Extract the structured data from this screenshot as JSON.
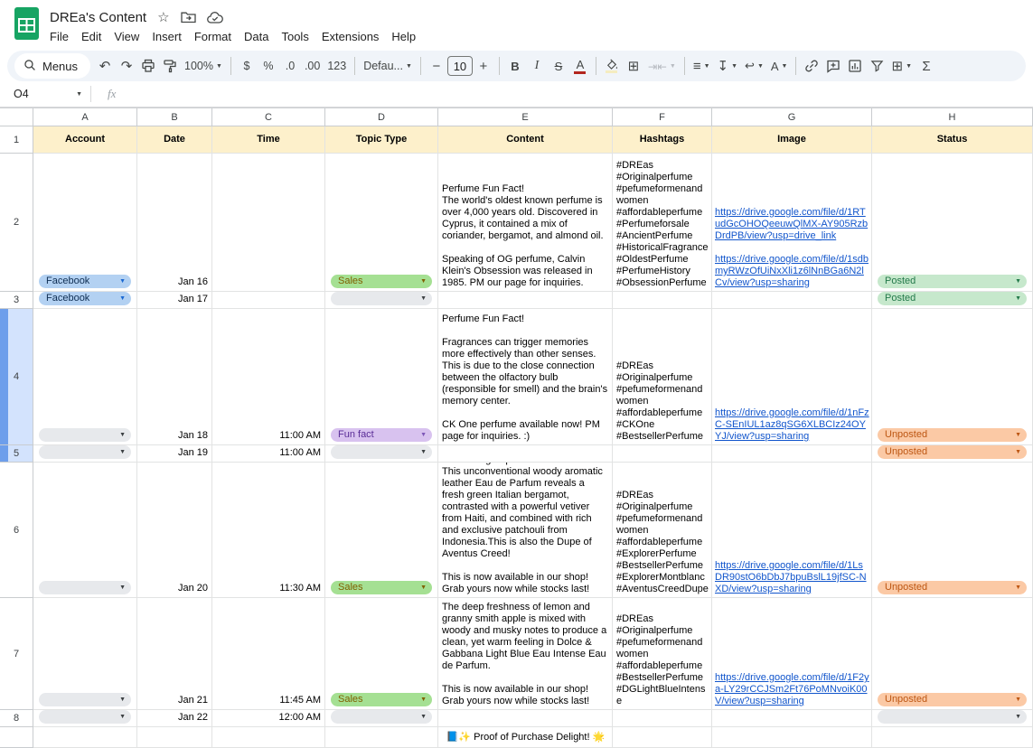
{
  "app": {
    "title": "DREa's Content",
    "menu_items": [
      "File",
      "Edit",
      "View",
      "Insert",
      "Format",
      "Data",
      "Tools",
      "Extensions",
      "Help"
    ]
  },
  "toolbar": {
    "menus_label": "Menus",
    "zoom_value": "100%",
    "currency": "$",
    "percent": "%",
    "decimal_decrease": ".0",
    "decimal_increase": ".00",
    "more_formats": "123",
    "font_family": "Defau...",
    "font_size": "10",
    "font_size_decrease": "−",
    "font_size_increase": "+",
    "bold": "B",
    "italic": "I",
    "strikethrough": "S",
    "text_color": "A",
    "text_rotation": "A",
    "sum": "Σ"
  },
  "icons": {
    "star": "☆",
    "undo": "↶",
    "redo": "↷",
    "caret": "▼",
    "align_left": "≡",
    "vertical_align": "↧",
    "text_wrap": "↩",
    "borders": "⊞",
    "merge_cells": "⇥⇤",
    "table": "⊞"
  },
  "formula_bar": {
    "cell_reference": "O4",
    "fx_label": "fx",
    "value": ""
  },
  "grid": {
    "column_letters": [
      "A",
      "B",
      "C",
      "D",
      "E",
      "F",
      "G",
      "H"
    ],
    "header_row": {
      "row_number": "1",
      "labels": [
        "Account",
        "Date",
        "Time",
        "Topic Type",
        "Content",
        "Hashtags",
        "Image",
        "Status"
      ]
    },
    "selected_rows": [
      "4",
      "5"
    ],
    "rows": [
      {
        "num": "2",
        "account": {
          "type": "facebook",
          "label": "Facebook"
        },
        "date": "Jan 16",
        "time": "",
        "topic": {
          "type": "sales",
          "label": "Sales"
        },
        "content": "Perfume Fun Fact!\nThe world's oldest known perfume is over 4,000 years old. Discovered in Cyprus, it contained a mix of coriander, bergamot, and almond oil.\n\nSpeaking of OG perfume, Calvin Klein's Obsession was released in 1985. PM our page for inquiries.",
        "hashtags": "#DREas\n#Originalperfume\n#pefumeformenandwomen\n#affordableperfume\n#Perfumeforsale\n#AncientPerfume\n#HistoricalFragrance\n#OldestPerfume\n#PerfumeHistory\n#ObsessionPerfume",
        "links": [
          "https://drive.google.com/file/d/1RTudGcOHOQeeuwQlMX-AY905RzbDrdPB/view?usp=drive_link",
          "https://drive.google.com/file/d/1sdbmyRWzOfUiNxXli1z6lNnBGa6N2lCv/view?usp=sharing"
        ],
        "status": {
          "type": "posted",
          "label": "Posted"
        }
      },
      {
        "num": "3",
        "account": {
          "type": "facebook",
          "label": "Facebook"
        },
        "date": "Jan 17",
        "time": "",
        "topic": {
          "type": "empty",
          "label": ""
        },
        "content": "",
        "hashtags": "",
        "links": [],
        "status": {
          "type": "posted",
          "label": "Posted"
        }
      },
      {
        "num": "4",
        "account": {
          "type": "empty",
          "label": ""
        },
        "date": "Jan 18",
        "time": "11:00 AM",
        "topic": {
          "type": "funfact",
          "label": "Fun fact"
        },
        "content": "Perfume Fun Fact!\n\nFragrances can trigger memories more effectively than other senses. This is due to the close connection between the olfactory bulb (responsible for smell) and the brain's memory center.\n\nCK One perfume available now! PM page for inquiries. :)",
        "hashtags": "#DREas\n#Originalperfume\n#pefumeformenandwomen\n#affordableperfume\n#CKOne\n#BestsellerPerfume",
        "links": [
          "https://drive.google.com/file/d/1nFzC-SEnIUL1az8qSG6XLBCIz24OYYJ/view?usp=sharing"
        ],
        "status": {
          "type": "unposted",
          "label": "Unposted"
        }
      },
      {
        "num": "5",
        "account": {
          "type": "empty",
          "label": ""
        },
        "date": "Jan 19",
        "time": "11:00 AM",
        "topic": {
          "type": "empty",
          "label": ""
        },
        "content": "",
        "hashtags": "",
        "links": [],
        "status": {
          "type": "unposted",
          "label": "Unposted"
        }
      },
      {
        "num": "6",
        "account": {
          "type": "empty",
          "label": ""
        },
        "date": "Jan 20",
        "time": "11:30 AM",
        "topic": {
          "type": "sales",
          "label": "Sales"
        },
        "content": "Introducing Explorer from Montblanc. This unconventional woody aromatic leather Eau de Parfum reveals a fresh green Italian bergamot, contrasted with a powerful vetiver from Haiti, and combined with rich and exclusive patchouli from Indonesia.This is also the Dupe of Aventus Creed!\n\nThis is now available in our shop! Grab yours now while stocks last!",
        "hashtags": "#DREas\n#Originalperfume\n#pefumeformenandwomen\n#affordableperfume\n#ExplorerPerfume\n#BestsellerPerfume\n#ExplorerMontblanc\n#AventusCreedDupe",
        "links": [
          "https://drive.google.com/file/d/1LsDR90stO6bDbJ7bpuBslL19jfSC-NXD/view?usp=sharing"
        ],
        "status": {
          "type": "unposted",
          "label": "Unposted"
        }
      },
      {
        "num": "7",
        "account": {
          "type": "empty",
          "label": ""
        },
        "date": "Jan 21",
        "time": "11:45 AM",
        "topic": {
          "type": "sales",
          "label": "Sales"
        },
        "content": "The deep freshness of lemon and granny smith apple is mixed with woody and musky notes to produce a clean, yet warm feeling in Dolce & Gabbana Light Blue Eau Intense Eau de Parfum.\n\nThis is now available in our shop! Grab yours now while stocks last!",
        "hashtags": "#DREas\n#Originalperfume\n#pefumeformenandwomen\n#affordableperfume\n#BestsellerPerfume\n#DGLightBlueIntense",
        "links": [
          "https://drive.google.com/file/d/1F2ya-LY29rCCJSm2Ft76PoMNvoiK00V/view?usp=sharing"
        ],
        "status": {
          "type": "unposted",
          "label": "Unposted"
        }
      },
      {
        "num": "8",
        "account": {
          "type": "empty",
          "label": ""
        },
        "date": "Jan 22",
        "time": "12:00 AM",
        "topic": {
          "type": "empty",
          "label": ""
        },
        "content": "",
        "hashtags": "",
        "links": [],
        "status": {
          "type": "empty",
          "label": ""
        }
      },
      {
        "num": "",
        "partial": true,
        "account": null,
        "date": "",
        "time": "",
        "topic": null,
        "content": "📘✨ Proof of Purchase Delight! 🌟",
        "content_align": "center",
        "hashtags": "",
        "links": [],
        "status": null
      }
    ]
  },
  "colors": {
    "toolbar_bg": "#f0f4f9",
    "header_row_bg": "#fdf0cb",
    "selected_row_header_bg": "#d3e3fd",
    "selected_row_accent": "#6d9eeb",
    "link": "#1155cc",
    "sheets_logo_green": "#17a463",
    "chips": {
      "facebook": {
        "bg": "#b3d1f2",
        "text": "#0f2e53",
        "caret": "#1967d2"
      },
      "sales": {
        "bg": "#a5e093",
        "text": "#7f6000",
        "caret": "#7f6000"
      },
      "funfact": {
        "bg": "#d8c2ef",
        "text": "#5a2d97",
        "caret": "#7e57b8"
      },
      "posted": {
        "bg": "#c6e8cc",
        "text": "#23794a",
        "caret": "#23794a"
      },
      "unposted": {
        "bg": "#fbc9a5",
        "text": "#bd5612",
        "caret": "#bd5612"
      },
      "empty": {
        "bg": "#e7e9ec",
        "text": "#3c4043",
        "caret": "#3c4043"
      }
    }
  }
}
